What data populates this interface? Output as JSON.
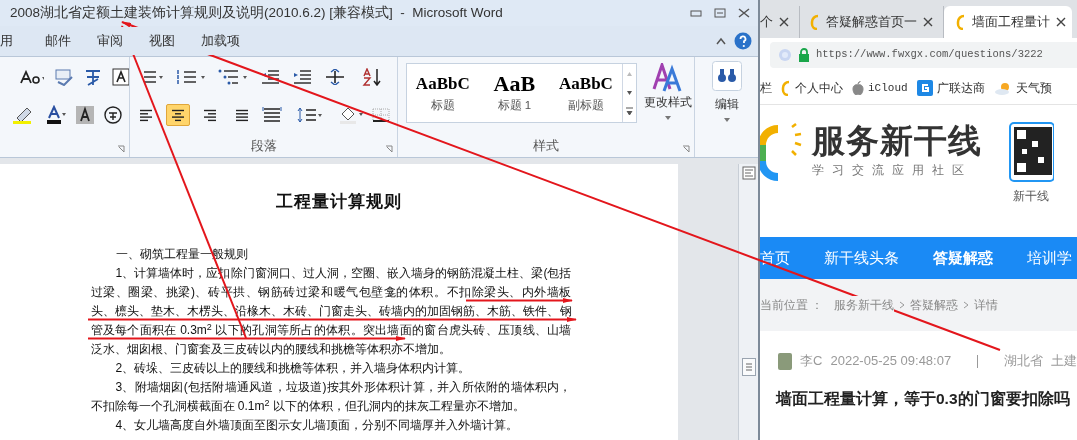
{
  "word": {
    "title": "2008湖北省定额土建装饰计算规则及说明(2010.6.2) [兼容模式]  -  Microsoft Word",
    "tabs": [
      {
        "label": "用",
        "selected": false
      },
      {
        "label": "邮件",
        "selected": false
      },
      {
        "label": "审阅",
        "selected": false
      },
      {
        "label": "视图",
        "selected": false
      },
      {
        "label": "加载项",
        "selected": false
      }
    ],
    "paragraph_group": {
      "label": "段落",
      "alignments": [
        {
          "kind": "left",
          "selected": false
        },
        {
          "kind": "center",
          "selected": true
        },
        {
          "kind": "right",
          "selected": false
        },
        {
          "kind": "justify",
          "selected": false
        }
      ]
    },
    "styles_group": {
      "label": "样式",
      "styles": [
        {
          "preview": "AaBbC",
          "label": "标题"
        },
        {
          "preview": "AaB",
          "label": "标题 1"
        },
        {
          "preview": "AaBbC",
          "label": "副标题"
        }
      ],
      "change_styles": "更改样式"
    },
    "edit_group": {
      "label": "编辑"
    },
    "document": {
      "heading": "工程量计算规则",
      "paragraphs": [
        {
          "kind": "section",
          "text": "一、砌筑工程量一般规则"
        },
        {
          "kind": "body",
          "text": "1、计算墙体时，应扣除门窗洞口、过人洞，空圈、嵌入墙身的钢筋混凝土柱、梁(包括过梁、圈梁、挑梁)、砖平拱、钢筋砖过梁和暖气包壁龛的体积。不扣除梁头、内外墙板头、檩头、垫木、木楞头、沿椽木、木砖、门窗走头、砖墙内的加固钢筋、木筋、铁件、钢管及每个面积在 0.3m$^{2}$ 以下的孔洞等所占的体积。突出墙面的窗台虎头砖、压顶线、山墙泛水、烟囱根、门窗套及三皮砖以内的腰线和挑檐等体积亦不增加。"
        },
        {
          "kind": "body",
          "text": "2、砖垛、三皮砖以上的腰线和挑檐等体积，并入墙身体积内计算。"
        },
        {
          "kind": "body",
          "text": "3、附墙烟囱(包括附墙通风道，垃圾道)按其外形体积计算，并入所依附的墙体积内，不扣除每一个孔洞横截面在 0.1m$^{2}$ 以下的体积，但孔洞内的抹灰工程量亦不增加。"
        },
        {
          "kind": "body",
          "text": "4、女儿墙高度自外墙顶面至图示女儿墙顶面，分别不同墙厚并入外墙计算。"
        }
      ]
    }
  },
  "browser": {
    "tabs": [
      {
        "label": "个",
        "selected": false
      },
      {
        "label": "答疑解惑首页一",
        "selected": false
      },
      {
        "label": "墙面工程量计",
        "selected": true
      }
    ],
    "url": "https://www.fwxgx.com/questions/3222",
    "bookmarks": [
      {
        "kind": "text",
        "label": "栏"
      },
      {
        "kind": "site",
        "label": "个人中心"
      },
      {
        "kind": "apple",
        "label": "iCloud"
      },
      {
        "kind": "g",
        "label": "广联达商"
      },
      {
        "kind": "weather",
        "label": "天气预"
      }
    ],
    "logo": {
      "name": "服务新干线",
      "tagline": "学习交流应用社区",
      "qr_caption": "新干线"
    },
    "nav": [
      {
        "label": "首页",
        "selected": false
      },
      {
        "label": "新干线头条",
        "selected": false
      },
      {
        "label": "答疑解惑",
        "selected": true
      },
      {
        "label": "培训学",
        "selected": false
      }
    ],
    "breadcrumb": {
      "prefix": "当前位置 ：",
      "items": [
        "服务新干线",
        "答疑解惑",
        "详情"
      ]
    },
    "post": {
      "author": "李C",
      "time": "2022-05-25 09:48:07",
      "tags": [
        "湖北省",
        "土建"
      ],
      "title": "墙面工程量计算，等于0.3的门窗要扣除吗"
    }
  }
}
